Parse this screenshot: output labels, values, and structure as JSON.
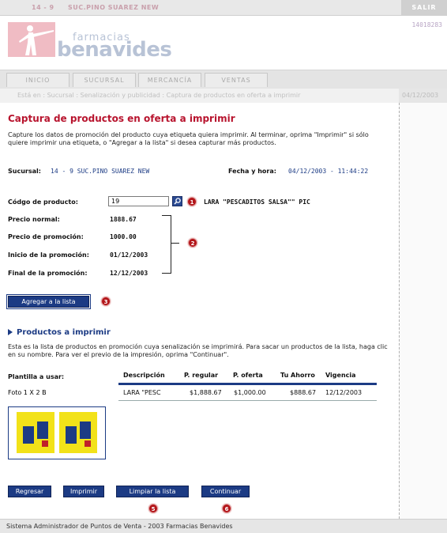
{
  "topbar": {
    "store_id": "14 - 9",
    "store_name": "SUC.PINO SUAREZ NEW",
    "logout": "SALIR",
    "session_code": "14018283"
  },
  "brand": {
    "top": "farmacias",
    "main": "benavides"
  },
  "nav": {
    "tabs": [
      "INICIO",
      "SUCURSAL",
      "MERCANCÍA",
      "VENTAS"
    ]
  },
  "breadcrumb": {
    "text": "Está en : Sucursal : Senalización y publicidad : Captura de productos en oferta a imprimir",
    "date": "04/12/2003"
  },
  "page": {
    "title": "Captura de productos en oferta a imprimir",
    "intro": "Capture los datos de promoción del producto cuya etiqueta quiera imprimir. Al terminar, oprima \"Imprimir\" si sólo quiere imprimir una etiqueta, o \"Agregar a la lista\" si desea capturar más productos."
  },
  "info": {
    "branch_label": "Sucursal:",
    "branch_value": "14 - 9  SUC.PINO SUAREZ NEW",
    "datetime_label": "Fecha y hora:",
    "datetime_value": "04/12/2003 - 11:44:22"
  },
  "form": {
    "code_label": "Códgo de producto:",
    "code_value": "19",
    "product_name": "LARA \"PESCADITOS SALSA\"\" PIC",
    "normal_price_label": "Precio normal:",
    "normal_price": "1888.67",
    "promo_price_label": "Precio de promoción:",
    "promo_price": "1000.00",
    "promo_start_label": "Inicio de la promoción:",
    "promo_start": "01/12/2003",
    "promo_end_label": "Final de la promoción:",
    "promo_end": "12/12/2003",
    "add_button": "Agregar a la lista"
  },
  "markers": [
    "1",
    "2",
    "3",
    "5",
    "6"
  ],
  "list": {
    "title": "Productos a imprimir",
    "intro": "Esta es la lista de productos en promoción cuya senalización se imprimirá. Para sacar un productos de la lista, haga clic en su nombre. Para ver el previo de la impresión, oprima \"Continuar\".",
    "template_label": "Plantilla a usar:",
    "template_value": "Foto 1 X 2 B",
    "columns": [
      "Descripción",
      "P. regular",
      "P. oferta",
      "Tu Ahorro",
      "Vigencia"
    ],
    "rows": [
      [
        "LARA \"PESC",
        "$1,888.67",
        "$1,000.00",
        "$888.67",
        "12/12/2003"
      ]
    ]
  },
  "actions": {
    "back": "Regresar",
    "print": "Imprimir",
    "clear": "Limpiar la lista",
    "continue": "Continuar"
  },
  "footer": {
    "text": "Sistema Administrador de Puntos de Venta - 2003 Farmacias Benavides"
  },
  "colors": {
    "accent_red": "#b8142e",
    "accent_blue": "#1c3b84",
    "marker_red": "#b3161a"
  }
}
